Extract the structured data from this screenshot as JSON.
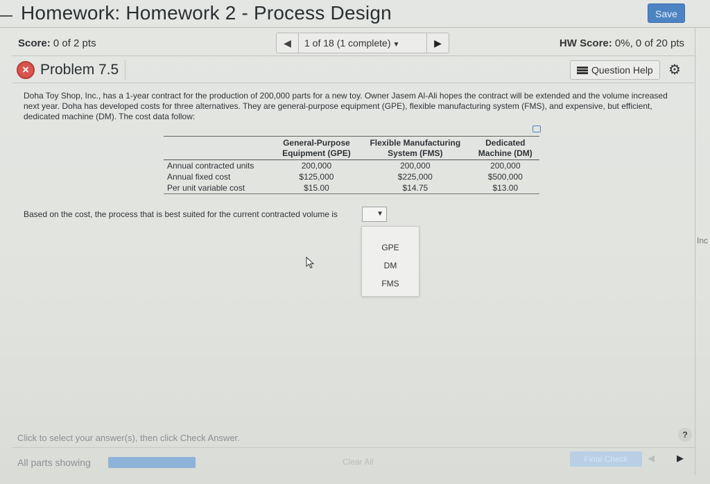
{
  "header": {
    "title": "Homework: Homework 2 - Process Design",
    "save_label": "Save"
  },
  "score_bar": {
    "score_label": "Score:",
    "score_value": "0 of 2 pts",
    "nav_label": "1 of 18 (1 complete)",
    "hw_score_label": "HW Score:",
    "hw_score_value": "0%, 0 of 20 pts"
  },
  "problem": {
    "title": "Problem 7.5",
    "question_help_label": "Question Help",
    "status": "incorrect"
  },
  "description": "Doha Toy Shop, Inc., has a 1-year contract for the production of 200,000 parts for a new toy. Owner Jasem Al-Ali hopes the contract will be extended and the volume increased next year. Doha has developed costs for three alternatives. They are general-purpose equipment (GPE), flexible manufacturing system (FMS), and expensive, but efficient, dedicated machine (DM). The cost data follow:",
  "cost_table": {
    "headers": [
      [
        "",
        ""
      ],
      [
        "General-Purpose",
        "Equipment (GPE)"
      ],
      [
        "Flexible Manufacturing",
        "System (FMS)"
      ],
      [
        "Dedicated",
        "Machine (DM)"
      ]
    ],
    "rows": [
      [
        "Annual contracted units",
        "200,000",
        "200,000",
        "200,000"
      ],
      [
        "Annual fixed cost",
        "$125,000",
        "$225,000",
        "$500,000"
      ],
      [
        "Per unit variable cost",
        "$15.00",
        "$14.75",
        "$13.00"
      ]
    ]
  },
  "question": {
    "text": "Based on the cost, the process that is best suited for the current contracted volume is",
    "selected_value": "",
    "options": [
      "GPE",
      "DM",
      "FMS"
    ]
  },
  "right_edge_text": "Inc",
  "footer": {
    "instructions": "Click to select your answer(s), then click Check Answer.",
    "help_label": "?",
    "parts_label": "All parts showing",
    "progress": 1.0,
    "clear_all_label": "Clear All",
    "final_check_label": "Final Check"
  },
  "colors": {
    "accent": "#4d83c3",
    "incorrect": "#d9534f",
    "background": "#e2e4e0"
  }
}
